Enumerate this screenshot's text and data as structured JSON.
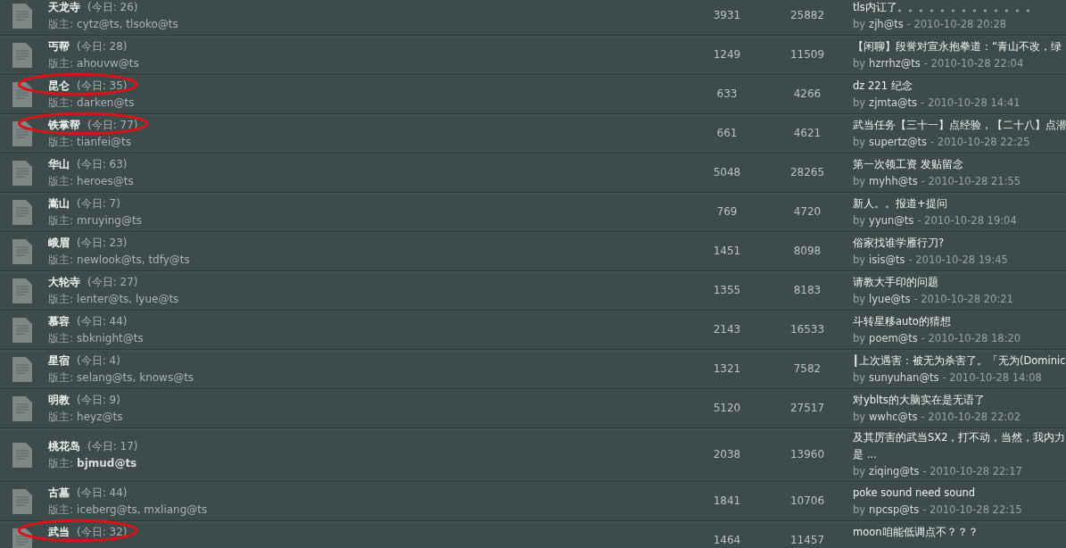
{
  "forums": [
    {
      "name": "天龙寺",
      "today": "(今日: 26)",
      "moderator_label": "版主:",
      "moderators": "cytz@ts, tlsoko@ts",
      "moderators_bold": false,
      "circled": false,
      "topics": "3931",
      "posts": "25882",
      "last_title": "tls内讧了。。。。。。。。。。。。。",
      "by": "by",
      "last_user": "zjh@ts",
      "last_time": "- 2010-10-28 20:28"
    },
    {
      "name": "丐帮",
      "today": "(今日: 28)",
      "moderator_label": "版主:",
      "moderators": "ahouvw@ts",
      "moderators_bold": false,
      "circled": false,
      "topics": "1249",
      "posts": "11509",
      "last_title": "【闲聊】段誉对宣永抱拳道：“青山不改，绿",
      "by": "by",
      "last_user": "hzrrhz@ts",
      "last_time": "- 2010-10-28 22:04"
    },
    {
      "name": "昆仑",
      "today": "(今日: 35)",
      "moderator_label": "版主:",
      "moderators": "darken@ts",
      "moderators_bold": false,
      "circled": true,
      "topics": "633",
      "posts": "4266",
      "last_title": "dz 221 纪念",
      "by": "by",
      "last_user": "zjmta@ts",
      "last_time": "- 2010-10-28 14:41"
    },
    {
      "name": "铁掌帮",
      "today": "(今日: 77)",
      "moderator_label": "版主:",
      "moderators": "tianfei@ts",
      "moderators_bold": false,
      "circled": true,
      "topics": "661",
      "posts": "4621",
      "last_title": "武当任务【三十一】点经验，【二十八】点潜",
      "by": "by",
      "last_user": "supertz@ts",
      "last_time": "- 2010-10-28 22:25"
    },
    {
      "name": "华山",
      "today": "(今日: 63)",
      "moderator_label": "版主:",
      "moderators": "heroes@ts",
      "moderators_bold": false,
      "circled": false,
      "topics": "5048",
      "posts": "28265",
      "last_title": "第一次领工资  发贴留念",
      "by": "by",
      "last_user": "myhh@ts",
      "last_time": "- 2010-10-28 21:55"
    },
    {
      "name": "嵩山",
      "today": "(今日: 7)",
      "moderator_label": "版主:",
      "moderators": "mruying@ts",
      "moderators_bold": false,
      "circled": false,
      "topics": "769",
      "posts": "4720",
      "last_title": "新人。。报道+提问",
      "by": "by",
      "last_user": "yyun@ts",
      "last_time": "- 2010-10-28 19:04"
    },
    {
      "name": "峨眉",
      "today": "(今日: 23)",
      "moderator_label": "版主:",
      "moderators": "newlook@ts, tdfy@ts",
      "moderators_bold": false,
      "circled": false,
      "topics": "1451",
      "posts": "8098",
      "last_title": "俗家找谁学雁行刀?",
      "by": "by",
      "last_user": "isis@ts",
      "last_time": "- 2010-10-28 19:45"
    },
    {
      "name": "大轮寺",
      "today": "(今日: 27)",
      "moderator_label": "版主:",
      "moderators": "lenter@ts, lyue@ts",
      "moderators_bold": false,
      "circled": false,
      "topics": "1355",
      "posts": "8183",
      "last_title": "请教大手印的问题",
      "by": "by",
      "last_user": "lyue@ts",
      "last_time": "- 2010-10-28 20:21"
    },
    {
      "name": "慕容",
      "today": "(今日: 44)",
      "moderator_label": "版主:",
      "moderators": "sbknight@ts",
      "moderators_bold": false,
      "circled": false,
      "topics": "2143",
      "posts": "16533",
      "last_title": "斗转星移auto的猜想",
      "by": "by",
      "last_user": "poem@ts",
      "last_time": "- 2010-10-28 18:20"
    },
    {
      "name": "星宿",
      "today": "(今日: 4)",
      "moderator_label": "版主:",
      "moderators": "selang@ts, knows@ts",
      "moderators_bold": false,
      "circled": false,
      "topics": "1321",
      "posts": "7582",
      "last_title": "┃上次遇害：被无为杀害了。「无为(Dominic",
      "by": "by",
      "last_user": "sunyuhan@ts",
      "last_time": "- 2010-10-28 14:08"
    },
    {
      "name": "明教",
      "today": "(今日: 9)",
      "moderator_label": "版主:",
      "moderators": "heyz@ts",
      "moderators_bold": false,
      "circled": false,
      "topics": "5120",
      "posts": "27517",
      "last_title": "对yblts的大脑实在是无语了",
      "by": "by",
      "last_user": "wwhc@ts",
      "last_time": "- 2010-10-28 22:02"
    },
    {
      "name": "桃花岛",
      "today": "(今日: 17)",
      "moderator_label": "版主:",
      "moderators": "bjmud@ts",
      "moderators_bold": true,
      "circled": false,
      "topics": "2038",
      "posts": "13960",
      "last_title": "及其厉害的武当SX2，打不动，当然，我内力",
      "last_title_more": "是 ...",
      "by": "by",
      "last_user": "ziqing@ts",
      "last_time": "- 2010-10-28 22:17"
    },
    {
      "name": "古墓",
      "today": "(今日: 44)",
      "moderator_label": "版主:",
      "moderators": "iceberg@ts, mxliang@ts",
      "moderators_bold": false,
      "circled": false,
      "topics": "1841",
      "posts": "10706",
      "last_title": "poke sound need sound",
      "by": "by",
      "last_user": "npcsp@ts",
      "last_time": "- 2010-10-28 22:15"
    },
    {
      "name": "武当",
      "today": "(今日: 32)",
      "circled": true,
      "topics": "1464",
      "posts": "11457",
      "last_title": "moon咱能低调点不？？？"
    }
  ]
}
